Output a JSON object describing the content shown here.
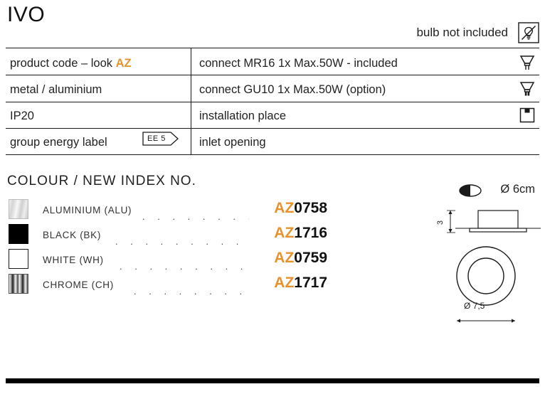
{
  "header": {
    "title": "IVO",
    "bulb_note": "bulb not included",
    "bulb_icon": "bulb-not-included-icon"
  },
  "spec_table": {
    "left_column": [
      {
        "label": "product code – look ",
        "accent": "AZ"
      },
      {
        "label": "metal / aluminium",
        "accent": ""
      },
      {
        "label": "IP20",
        "accent": ""
      },
      {
        "label": "group energy label",
        "accent": ""
      }
    ],
    "energy_badge": "EE 5",
    "right_column": [
      {
        "label": "connect MR16 1x Max.50W - included",
        "icon": "mr16-lamp-icon"
      },
      {
        "label": "connect GU10 1x Max.50W (option)",
        "icon": "gu10-lamp-icon"
      },
      {
        "label": "installation place",
        "icon": "ceiling-mount-icon"
      },
      {
        "label": "inlet opening",
        "icon": "inlet-opening-icon",
        "value": "Ø 6cm"
      }
    ]
  },
  "colour_section": {
    "heading": "COLOUR / NEW INDEX NO.",
    "items": [
      {
        "name": "ALUMINIUM (ALU)",
        "prefix": "AZ",
        "number": "0758",
        "swatch": "aluminium-swatch"
      },
      {
        "name": "BLACK (BK)",
        "prefix": "AZ",
        "number": "1716",
        "swatch": "black-swatch"
      },
      {
        "name": "WHITE (WH)",
        "prefix": "AZ",
        "number": "0759",
        "swatch": "white-swatch"
      },
      {
        "name": "CHROME (CH)",
        "prefix": "AZ",
        "number": "1717",
        "swatch": "chrome-swatch"
      }
    ]
  },
  "drawings": {
    "height_label": "3",
    "diameter_label": "Ø 7,5"
  },
  "colors": {
    "accent_orange": "#e8922e",
    "text": "#222222",
    "rule": "#1a1a1a"
  }
}
